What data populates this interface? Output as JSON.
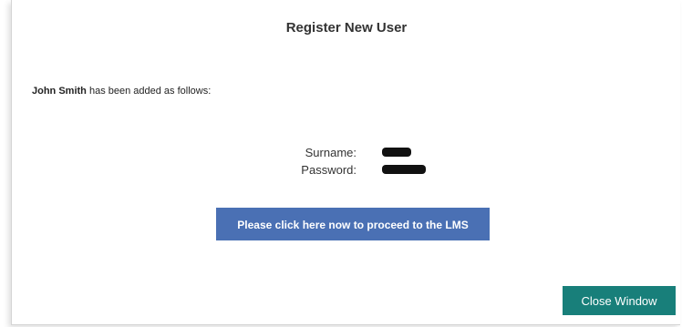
{
  "dialog": {
    "title": "Register New User",
    "added_user_name": "John Smith",
    "added_message": "has been added as follows:"
  },
  "details": {
    "surname_label": "Surname:",
    "password_label": "Password:"
  },
  "actions": {
    "proceed_label": "Please click here now to proceed to the LMS",
    "close_label": "Close Window"
  },
  "colors": {
    "proceed_button": "#4a70b4",
    "close_button": "#187f7a"
  }
}
